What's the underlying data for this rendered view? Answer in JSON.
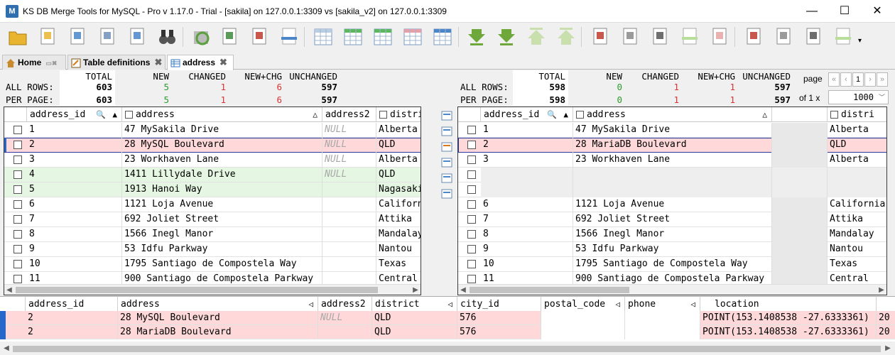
{
  "window": {
    "title": "KS DB Merge Tools for MySQL - Pro v 1.17.0 - Trial - [sakila] on 127.0.0.1:3309 vs [sakila_v2] on 127.0.0.1:3309",
    "app_icon": "M",
    "minimize": "—",
    "maximize": "☐",
    "close": "✕"
  },
  "toolbar": {
    "icons": [
      "open-folder-icon",
      "open-recent-icon",
      "compare-icon",
      "select-icon",
      "data-diff-icon",
      "binoculars-icon",
      "refresh-icon",
      "export-excel-icon",
      "script-icon",
      "copy-document-icon",
      "grid-plain-icon",
      "grid-green-icon",
      "grid-green2-icon",
      "grid-red-icon",
      "grid-blue-icon",
      "merge-down-icon",
      "merge-down2-icon",
      "merge-up-icon",
      "merge-up2-icon",
      "check-doc-icon",
      "doc-icon",
      "link-doc-icon",
      "copy-right-icon",
      "delete-doc-icon",
      "check-doc2-icon",
      "doc2-icon",
      "link-doc2-icon",
      "copy-left-icon"
    ],
    "more": "▾"
  },
  "tabs": [
    {
      "label": "Home",
      "icon": "home-icon"
    },
    {
      "label": "Table definitions",
      "icon": "table-def-icon"
    },
    {
      "label": "address",
      "icon": "table-icon"
    }
  ],
  "stats_left": {
    "headers": {
      "total": "TOTAL",
      "new": "NEW",
      "changed": "CHANGED",
      "newchg": "NEW+CHG",
      "unchanged": "UNCHANGED"
    },
    "all_rows_label": "ALL ROWS:",
    "per_page_label": "PER PAGE:",
    "all_rows": {
      "total": "603",
      "new": "5",
      "changed": "1",
      "newchg": "6",
      "unchanged": "597"
    },
    "per_page": {
      "total": "603",
      "new": "5",
      "changed": "1",
      "newchg": "6",
      "unchanged": "597"
    }
  },
  "stats_right": {
    "headers": {
      "total": "TOTAL",
      "new": "NEW",
      "changed": "CHANGED",
      "newchg": "NEW+CHG",
      "unchanged": "UNCHANGED"
    },
    "all_rows_label": "ALL ROWS:",
    "per_page_label": "PER PAGE:",
    "all_rows": {
      "total": "598",
      "new": "0",
      "changed": "1",
      "newchg": "1",
      "unchanged": "597"
    },
    "per_page": {
      "total": "598",
      "new": "0",
      "changed": "1",
      "newchg": "1",
      "unchanged": "597"
    }
  },
  "paging": {
    "page_label": "page",
    "page": "1",
    "of_label": "of 1 x",
    "per_page": "1000",
    "first": "«",
    "prev": "‹",
    "next": "›",
    "last": "»"
  },
  "left_grid": {
    "columns": [
      "address_id",
      "address",
      "address2",
      "distri"
    ],
    "sort": "▲",
    "sort2": "△",
    "rows": [
      {
        "id": "1",
        "address": "47 MySakila Drive",
        "address2": "NULL",
        "district": "Alberta",
        "state": ""
      },
      {
        "id": "2",
        "address": "28 MySQL Boulevard",
        "address2": "NULL",
        "district": "QLD",
        "state": "changed"
      },
      {
        "id": "3",
        "address": "23 Workhaven Lane",
        "address2": "NULL",
        "district": "Alberta",
        "state": ""
      },
      {
        "id": "4",
        "address": "1411 Lillydale Drive",
        "address2": "NULL",
        "district": "QLD",
        "state": "new"
      },
      {
        "id": "5",
        "address": "1913 Hanoi Way",
        "address2": "",
        "district": "Nagasaki",
        "state": "new"
      },
      {
        "id": "6",
        "address": "1121 Loja Avenue",
        "address2": "",
        "district": "California",
        "state": ""
      },
      {
        "id": "7",
        "address": "692 Joliet Street",
        "address2": "",
        "district": "Attika",
        "state": ""
      },
      {
        "id": "8",
        "address": "1566 Inegl Manor",
        "address2": "",
        "district": "Mandalay",
        "state": ""
      },
      {
        "id": "9",
        "address": "53 Idfu Parkway",
        "address2": "",
        "district": "Nantou",
        "state": ""
      },
      {
        "id": "10",
        "address": "1795 Santiago de Compostela Way",
        "address2": "",
        "district": "Texas",
        "state": ""
      },
      {
        "id": "11",
        "address": "900 Santiago de Compostela Parkway",
        "address2": "",
        "district": "Central",
        "state": ""
      }
    ]
  },
  "right_grid": {
    "columns": [
      "address_id",
      "address",
      "",
      "distri"
    ],
    "sort": "▲",
    "sort2": "△",
    "rows": [
      {
        "id": "1",
        "address": "47 MySakila Drive",
        "district": "Alberta",
        "state": ""
      },
      {
        "id": "2",
        "address": "28 MariaDB Boulevard",
        "district": "QLD",
        "state": "changed"
      },
      {
        "id": "3",
        "address": "23 Workhaven Lane",
        "district": "Alberta",
        "state": ""
      },
      {
        "id": "",
        "address": "",
        "district": "",
        "state": "empty"
      },
      {
        "id": "",
        "address": "",
        "district": "",
        "state": "empty"
      },
      {
        "id": "6",
        "address": "1121 Loja Avenue",
        "district": "California",
        "state": ""
      },
      {
        "id": "7",
        "address": "692 Joliet Street",
        "district": "Attika",
        "state": ""
      },
      {
        "id": "8",
        "address": "1566 Inegl Manor",
        "district": "Mandalay",
        "state": ""
      },
      {
        "id": "9",
        "address": "53 Idfu Parkway",
        "district": "Nantou",
        "state": ""
      },
      {
        "id": "10",
        "address": "1795 Santiago de Compostela Way",
        "district": "Texas",
        "state": ""
      },
      {
        "id": "11",
        "address": "900 Santiago de Compostela Parkway",
        "district": "Central",
        "state": ""
      }
    ]
  },
  "bottom_grid": {
    "columns": [
      "address_id",
      "address",
      "address2",
      "district",
      "city_id",
      "postal_code",
      "phone",
      "location",
      ""
    ],
    "sort": "◁",
    "rows": [
      {
        "id": "2",
        "address": "28 MySQL Boulevard",
        "address2": "NULL",
        "district": "QLD",
        "city_id": "576",
        "postal_code": "",
        "phone": "",
        "location": "POINT(153.1408538 -27.6333361)",
        "extra": "20"
      },
      {
        "id": "2",
        "address": "28 MariaDB Boulevard",
        "address2": "",
        "district": "QLD",
        "city_id": "576",
        "postal_code": "",
        "phone": "",
        "location": "POINT(153.1408538 -27.6333361)",
        "extra": "20"
      }
    ]
  },
  "colors": {
    "changed": "#ffd9d9",
    "new": "#e5f7e2",
    "marker": "#2667c9",
    "new_count": "#2e9b2e",
    "changed_count": "#d83434"
  }
}
